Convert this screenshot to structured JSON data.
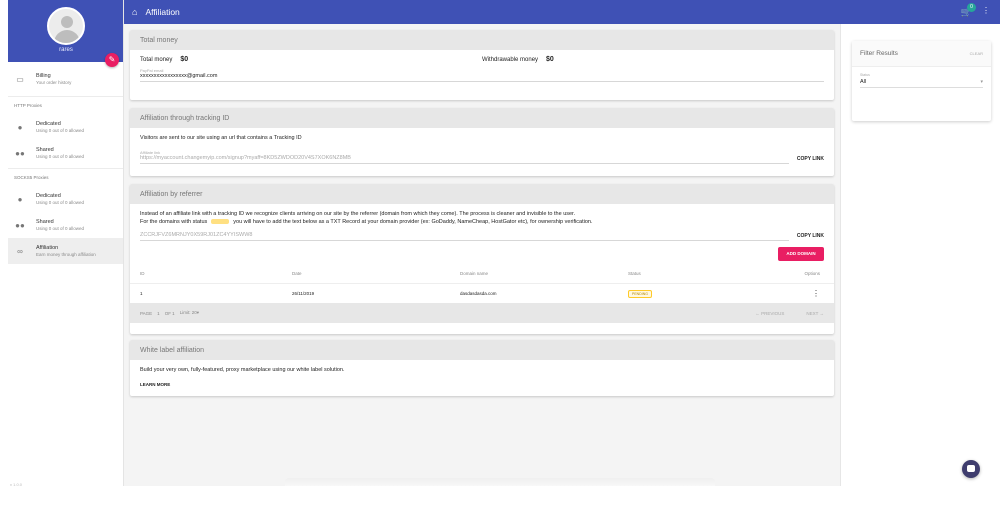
{
  "sidebar": {
    "username": "rares",
    "billing": {
      "label": "Billing",
      "sub": "Your order history"
    },
    "http_section": "HTTP Proxies",
    "http_dedicated": {
      "label": "Dedicated",
      "sub": "Using 0 out of 0 allowed"
    },
    "http_shared": {
      "label": "Shared",
      "sub": "Using 0 out of 0 allowed"
    },
    "socks_section": "SOCKS5 Proxies",
    "socks_dedicated": {
      "label": "Dedicated",
      "sub": "Using 0 out of 0 allowed"
    },
    "socks_shared": {
      "label": "Shared",
      "sub": "Using 0 out of 0 allowed"
    },
    "affiliation": {
      "label": "Affiliation",
      "sub": "Earn money through affiliation"
    },
    "footer": "v 1.0.0"
  },
  "topbar": {
    "title": "Affiliation",
    "cart_count": "0"
  },
  "total_money": {
    "header": "Total money",
    "total_label": "Total money",
    "total_value": "$0",
    "withdrawable_label": "Withdrawable money",
    "withdrawable_value": "$0",
    "paypal_label": "PayPal email",
    "paypal_value": "xxxxxxxxxxxxxxxxx@gmail.com"
  },
  "tracking": {
    "header": "Affiliation through tracking ID",
    "desc": "Visitors are sent to our site using an url that contains a Tracking ID",
    "field_label": "Affiliate link",
    "field_value": "https://myaccount.changemyip.com/signup?myaff=8KD5ZWDOD20V4S7XOK6NZ8MB",
    "copy": "COPY LINK"
  },
  "referrer": {
    "header": "Affiliation by referrer",
    "desc1": "Instead of an affiliate link with a tracking ID we recognize clients arriving on our site by the referrer (domain from which they come). The process is cleaner and invisible to the user.",
    "desc2a": "For the domains with status",
    "desc2b": "you will have to add the text below as a TXT Record at your domain provider (ex: GoDaddy, NameCheap, HostGator etc), for ownership verification.",
    "txt_value": "ZCCRJFVZ6MRNJY0X59RJ01ZC4YYISWW8",
    "copy": "COPY LINK",
    "add_domain": "ADD DOMAIN",
    "columns": [
      "ID",
      "Date",
      "Domain name",
      "Status",
      "Options"
    ],
    "rows": [
      {
        "id": "1",
        "date": "26/11/2019",
        "domain": "dasdasdasda.com",
        "status": "PENDING"
      }
    ],
    "pager": {
      "page": "PAGE",
      "page_num": "1",
      "of": "OF 1",
      "limit": "Limit: 20",
      "prev": "← PREVIOUS",
      "next": "NEXT →"
    }
  },
  "white_label": {
    "header": "White label affiliation",
    "desc": "Build your very own, fully-featured, proxy marketplace using our white label solution.",
    "learn_more": "LEARN MORE"
  },
  "filter": {
    "title": "Filter Results",
    "clear": "CLEAR",
    "status_label": "Status",
    "status_value": "All"
  },
  "colors": {
    "primary": "#3f51b5",
    "accent": "#e91e63",
    "pending": "#ffca28"
  },
  "icons": [
    "home-icon",
    "cart-icon",
    "more-vert-icon",
    "edit-icon",
    "billing-icon",
    "person-icon",
    "group-icon",
    "link-icon",
    "chat-icon"
  ]
}
